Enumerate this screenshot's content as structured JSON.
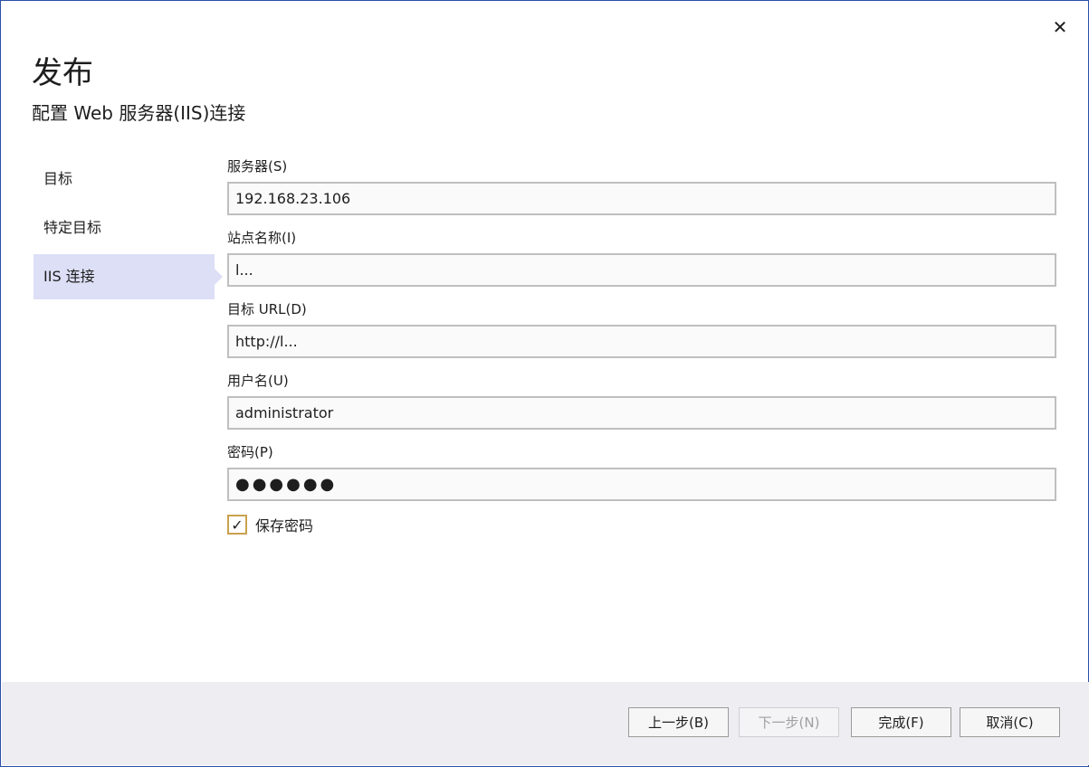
{
  "window": {
    "title": "发布",
    "subtitle": "配置 Web 服务器(IIS)连接",
    "close_glyph": "✕"
  },
  "nav": {
    "items": [
      {
        "label": "目标",
        "active": false
      },
      {
        "label": "特定目标",
        "active": false
      },
      {
        "label": "IIS 连接",
        "active": true
      }
    ]
  },
  "form": {
    "server": {
      "label": "服务器(S)",
      "value": "192.168.23.106"
    },
    "site_name": {
      "label": "站点名称(I)",
      "value": "l..."
    },
    "dest_url": {
      "label": "目标 URL(D)",
      "value": "http://l..."
    },
    "username": {
      "label": "用户名(U)",
      "value": "administrator"
    },
    "password": {
      "label": "密码(P)",
      "value": "●●●●●●"
    },
    "save_password": {
      "label": "保存密码",
      "checked": true,
      "check_glyph": "✓"
    }
  },
  "footer": {
    "prev_label": "上一步(B)",
    "next_label": "下一步(N)",
    "finish_label": "完成(F)",
    "cancel_label": "取消(C)"
  },
  "colors": {
    "nav_active_bg": "#dcdff5",
    "window_border": "#2b4fa6",
    "footer_bg": "#eeeef2",
    "checkbox_border": "#c9a24e"
  }
}
